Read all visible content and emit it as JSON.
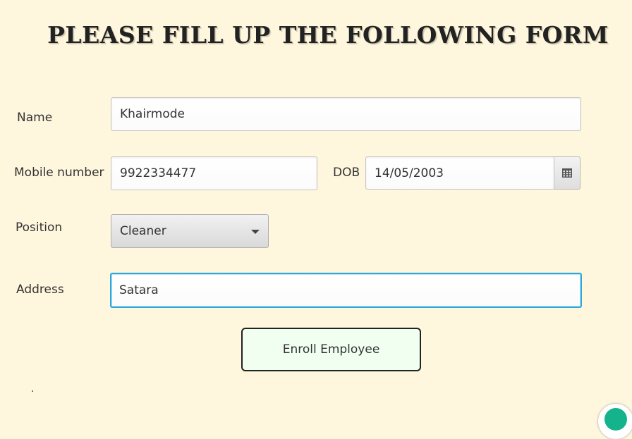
{
  "form": {
    "title": "PLEASE FILL UP THE FOLLOWING FORM",
    "name_label": "Name",
    "name_value": "Khairmode",
    "mobile_label": "Mobile number",
    "mobile_value": "9922334477",
    "dob_label": "DOB",
    "dob_value": "14/05/2003",
    "position_label": "Position",
    "position_value": "Cleaner",
    "address_label": "Address",
    "address_value": "Satara",
    "enroll_label": "Enroll Employee",
    "footer_dot": "."
  },
  "icons": {
    "calendar": "calendar-icon",
    "dropdown": "chevron-down-icon",
    "assistant": "assistant-bubble-icon"
  },
  "colors": {
    "background": "#fef6dd",
    "focus": "#2da7dd",
    "button_bg": "#f0fff0",
    "assistant": "#14b38c"
  }
}
